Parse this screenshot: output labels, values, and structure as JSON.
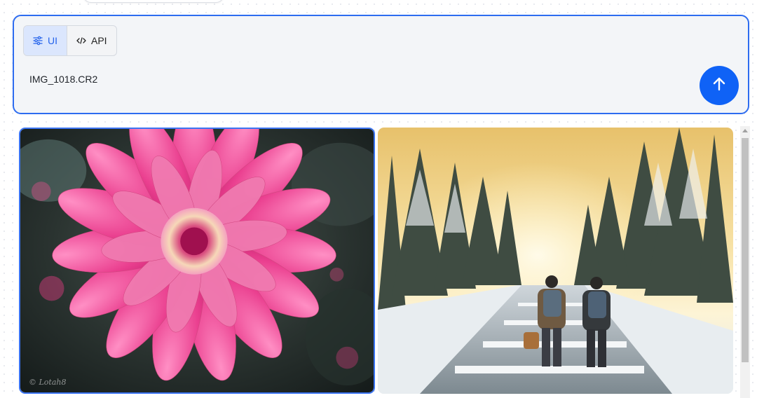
{
  "mode_toggle": {
    "ui_label": "UI",
    "api_label": "API",
    "active": "UI"
  },
  "prompt": {
    "value": "IMG_1018.CR2"
  },
  "gallery": {
    "items": [
      {
        "subject": "pink dahlia flower",
        "selected": true,
        "watermark": "© Lotah8"
      },
      {
        "subject": "two hikers walking a snowy forest road at sunrise",
        "selected": false
      }
    ]
  },
  "colors": {
    "accent": "#2d6cf0",
    "submit": "#0f62f6",
    "active_toggle_bg": "#dbe6fd"
  },
  "icons": {
    "ui": "sliders-icon",
    "api": "code-icon",
    "submit": "arrow-up-icon"
  }
}
